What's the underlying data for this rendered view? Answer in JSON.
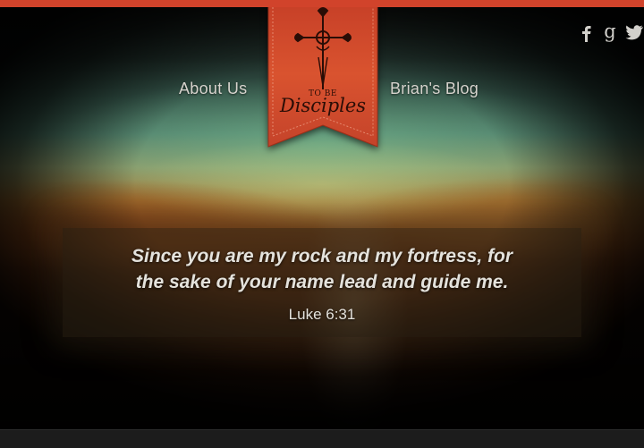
{
  "colors": {
    "accent": "#d1432b",
    "banner_red": "#d54a2e",
    "text_light": "#e4e2dc",
    "footer_bar": "#1c1c1c"
  },
  "nav": {
    "about_label": "About Us",
    "blog_label": "Brian's Blog"
  },
  "logo": {
    "line1": "TO BE",
    "line2": "Disciples",
    "icon": "cross-icon"
  },
  "social": [
    {
      "name": "facebook",
      "glyph": "f",
      "icon": "facebook-icon"
    },
    {
      "name": "google-plus",
      "glyph": "g",
      "icon": "google-plus-icon"
    },
    {
      "name": "twitter",
      "glyph": "",
      "icon": "twitter-icon"
    }
  ],
  "hero": {
    "quote_line1": "Since you are my rock and my fortress, for",
    "quote_line2": "the sake of your name lead and guide me.",
    "reference": "Luke 6:31"
  }
}
